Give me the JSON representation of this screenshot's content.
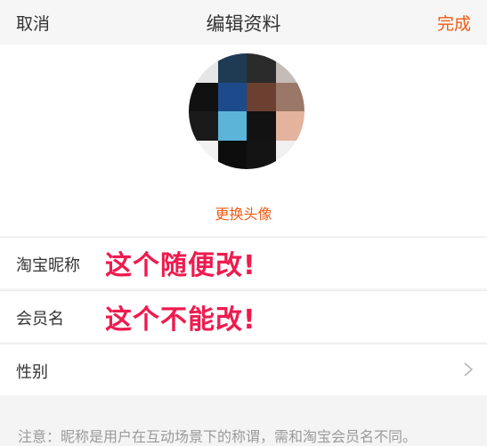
{
  "nav": {
    "cancel_label": "取消",
    "title": "编辑资料",
    "done_label": "完成",
    "accent_color": "#ef5a14"
  },
  "avatar": {
    "change_label": "更换头像"
  },
  "fields": [
    {
      "label": "淘宝昵称",
      "annotation": "这个随便改!"
    },
    {
      "label": "会员名",
      "annotation": "这个不能改!"
    },
    {
      "label": "性别",
      "icon": "chevron-right-icon"
    }
  ],
  "footer_note": "注意：昵称是用户在互动场景下的称谓，需和淘宝会员名不同。",
  "annotation_color": "#ee1b4f"
}
